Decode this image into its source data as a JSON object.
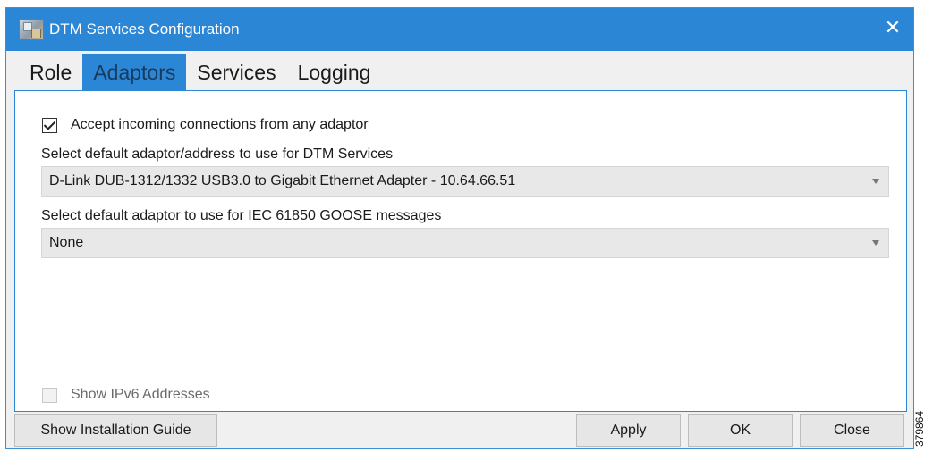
{
  "window": {
    "title": "DTM Services Configuration",
    "close_glyph": "✕",
    "title_bar_color": "#2b86d6",
    "icon": "app-icon"
  },
  "tabs": [
    {
      "label": "Role",
      "active": false
    },
    {
      "label": "Adaptors",
      "active": true
    },
    {
      "label": "Services",
      "active": false
    },
    {
      "label": "Logging",
      "active": false
    }
  ],
  "adaptors": {
    "accept_incoming": {
      "label": "Accept incoming connections from any adaptor",
      "checked": true
    },
    "default_adaptor": {
      "label": "Select default adaptor/address to use for DTM Services",
      "value": "D-Link DUB-1312/1332 USB3.0 to Gigabit Ethernet Adapter - 10.64.66.51"
    },
    "goose_adaptor": {
      "label": "Select default adaptor to use for IEC 61850 GOOSE messages",
      "value": "None"
    },
    "show_ipv6": {
      "label": "Show IPv6 Addresses",
      "checked": false,
      "enabled": false
    }
  },
  "buttons": {
    "install_guide": "Show Installation Guide",
    "apply": "Apply",
    "ok": "OK",
    "close": "Close"
  },
  "side_label": "379864"
}
